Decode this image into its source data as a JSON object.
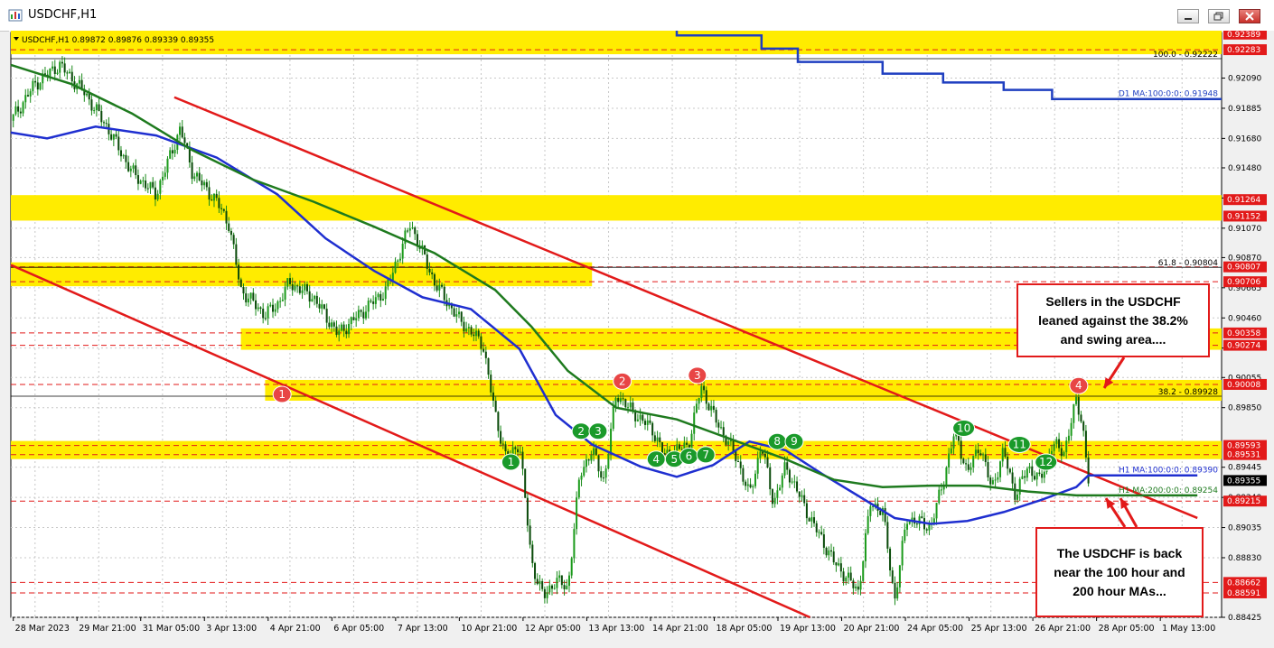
{
  "window": {
    "title": "USDCHF,H1",
    "icon": "chart-window-icon",
    "buttons": [
      "minimize-icon",
      "restore-icon",
      "close-icon"
    ]
  },
  "chart_data": {
    "type": "candlestick",
    "title": "USDCHF,H1",
    "symbol_info": "USDCHF,H1  0.89872 0.89876 0.89339 0.89355",
    "ylim": [
      0.88425,
      0.924
    ],
    "y_ticks": [
      "0.92090",
      "0.91885",
      "0.91680",
      "0.91480",
      "0.91275",
      "0.91070",
      "0.90870",
      "0.90665",
      "0.90460",
      "0.90255",
      "0.90055",
      "0.89850",
      "0.89445",
      "0.89240",
      "0.89035",
      "0.88830",
      "0.88425"
    ],
    "x_ticks": [
      "28 Mar 2023",
      "29 Mar 21:00",
      "31 Mar 05:00",
      "3 Apr 13:00",
      "4 Apr 21:00",
      "6 Apr 05:00",
      "7 Apr 13:00",
      "10 Apr 21:00",
      "12 Apr 05:00",
      "13 Apr 13:00",
      "14 Apr 21:00",
      "18 Apr 05:00",
      "19 Apr 13:00",
      "20 Apr 21:00",
      "24 Apr 05:00",
      "25 Apr 13:00",
      "26 Apr 21:00",
      "28 Apr 05:00",
      "1 May 13:00"
    ],
    "price_labels": [
      {
        "text": "0.92389",
        "value": 0.92389,
        "color": "#e21a1a"
      },
      {
        "text": "0.92283",
        "value": 0.92283,
        "color": "#e21a1a"
      },
      {
        "text": "0.91264",
        "value": 0.91264,
        "color": "#e21a1a"
      },
      {
        "text": "0.91152",
        "value": 0.91152,
        "color": "#e21a1a"
      },
      {
        "text": "0.90807",
        "value": 0.90807,
        "color": "#e21a1a"
      },
      {
        "text": "0.90706",
        "value": 0.90706,
        "color": "#e21a1a"
      },
      {
        "text": "0.90358",
        "value": 0.90358,
        "color": "#e21a1a"
      },
      {
        "text": "0.90274",
        "value": 0.90274,
        "color": "#e21a1a"
      },
      {
        "text": "0.90008",
        "value": 0.90008,
        "color": "#e21a1a"
      },
      {
        "text": "0.89593",
        "value": 0.89593,
        "color": "#e21a1a"
      },
      {
        "text": "0.89531",
        "value": 0.89531,
        "color": "#e21a1a"
      },
      {
        "text": "0.89355",
        "value": 0.89355,
        "color": "#000000"
      },
      {
        "text": "0.89215",
        "value": 0.89215,
        "color": "#e21a1a"
      },
      {
        "text": "0.88662",
        "value": 0.88662,
        "color": "#e21a1a"
      },
      {
        "text": "0.88591",
        "value": 0.88591,
        "color": "#e21a1a"
      }
    ],
    "zones": [
      {
        "lo": 0.92283,
        "hi": 0.92389,
        "from": 0.0,
        "to": 1.0
      },
      {
        "lo": 0.91152,
        "hi": 0.91264,
        "from": 0.0,
        "to": 1.0
      },
      {
        "lo": 0.90706,
        "hi": 0.90807,
        "from": 0.0,
        "to": 0.48
      },
      {
        "lo": 0.90274,
        "hi": 0.90358,
        "from": 0.19,
        "to": 1.0
      },
      {
        "lo": 0.89928,
        "hi": 0.90008,
        "from": 0.21,
        "to": 1.0
      },
      {
        "lo": 0.89531,
        "hi": 0.89593,
        "from": 0.0,
        "to": 1.0
      }
    ],
    "dashed_levels": [
      0.92283,
      0.90807,
      0.90706,
      0.90358,
      0.90274,
      0.90008,
      0.89593,
      0.89531,
      0.89215,
      0.88662,
      0.88591
    ],
    "fib_levels": [
      {
        "label": "100.0 - 0.92222",
        "value": 0.92222
      },
      {
        "label": "61.8 - 0.90804",
        "value": 0.90804
      },
      {
        "label": "38.2 - 0.89928",
        "value": 0.89928
      }
    ],
    "series": [
      {
        "name": "D1 MA:100:0:0: 0.91948",
        "color": "#1f3fc0",
        "points": [
          [
            0.51,
            0.9243
          ],
          [
            0.55,
            0.9243
          ],
          [
            0.55,
            0.9238
          ],
          [
            0.62,
            0.9238
          ],
          [
            0.62,
            0.9229
          ],
          [
            0.65,
            0.9229
          ],
          [
            0.65,
            0.922
          ],
          [
            0.72,
            0.922
          ],
          [
            0.72,
            0.9212
          ],
          [
            0.77,
            0.9212
          ],
          [
            0.77,
            0.9206
          ],
          [
            0.82,
            0.9206
          ],
          [
            0.82,
            0.9201
          ],
          [
            0.86,
            0.9201
          ],
          [
            0.86,
            0.91948
          ],
          [
            1.0,
            0.91948
          ]
        ]
      },
      {
        "name": "H1 MA:100:0:0: 0.89390",
        "color": "#1f2fd0",
        "points": [
          [
            0,
            0.9172
          ],
          [
            0.03,
            0.9168
          ],
          [
            0.07,
            0.9176
          ],
          [
            0.12,
            0.917
          ],
          [
            0.17,
            0.9155
          ],
          [
            0.22,
            0.913
          ],
          [
            0.26,
            0.91
          ],
          [
            0.3,
            0.9078
          ],
          [
            0.34,
            0.906
          ],
          [
            0.38,
            0.9052
          ],
          [
            0.42,
            0.9025
          ],
          [
            0.45,
            0.898
          ],
          [
            0.48,
            0.896
          ],
          [
            0.52,
            0.8945
          ],
          [
            0.55,
            0.8938
          ],
          [
            0.58,
            0.8946
          ],
          [
            0.61,
            0.8962
          ],
          [
            0.64,
            0.8956
          ],
          [
            0.67,
            0.894
          ],
          [
            0.7,
            0.8925
          ],
          [
            0.73,
            0.891
          ],
          [
            0.76,
            0.8906
          ],
          [
            0.79,
            0.8908
          ],
          [
            0.82,
            0.8914
          ],
          [
            0.85,
            0.8922
          ],
          [
            0.88,
            0.8931
          ],
          [
            0.89,
            0.8939
          ],
          [
            0.98,
            0.8939
          ]
        ]
      },
      {
        "name": "H1 MA:200:0:0: 0.89254",
        "color": "#1e7a1e",
        "points": [
          [
            0,
            0.9218
          ],
          [
            0.05,
            0.9205
          ],
          [
            0.1,
            0.9185
          ],
          [
            0.15,
            0.916
          ],
          [
            0.2,
            0.914
          ],
          [
            0.25,
            0.9125
          ],
          [
            0.3,
            0.9108
          ],
          [
            0.35,
            0.909
          ],
          [
            0.4,
            0.9065
          ],
          [
            0.43,
            0.904
          ],
          [
            0.46,
            0.901
          ],
          [
            0.5,
            0.8985
          ],
          [
            0.55,
            0.8977
          ],
          [
            0.6,
            0.8962
          ],
          [
            0.64,
            0.895
          ],
          [
            0.68,
            0.8936
          ],
          [
            0.72,
            0.8931
          ],
          [
            0.76,
            0.8932
          ],
          [
            0.8,
            0.8932
          ],
          [
            0.84,
            0.8928
          ],
          [
            0.88,
            0.89254
          ],
          [
            0.98,
            0.89254
          ]
        ]
      }
    ],
    "channel_lines": [
      {
        "from": [
          0.135,
          0.9196
        ],
        "to": [
          0.98,
          0.891
        ]
      },
      {
        "from": [
          0.0,
          0.9082
        ],
        "to": [
          0.66,
          0.88425
        ]
      }
    ],
    "labels": [
      {
        "text": "1",
        "x": 0.224,
        "y": 0.8994,
        "color": "#e84545"
      },
      {
        "text": "2",
        "x": 0.505,
        "y": 0.9003,
        "color": "#e84545"
      },
      {
        "text": "3",
        "x": 0.567,
        "y": 0.9007,
        "color": "#e84545"
      },
      {
        "text": "4",
        "x": 0.882,
        "y": 0.9,
        "color": "#e84545"
      },
      {
        "text": "1",
        "x": 0.413,
        "y": 0.8948,
        "color": "#1a9a2a"
      },
      {
        "text": "2",
        "x": 0.471,
        "y": 0.8969,
        "color": "#1a9a2a"
      },
      {
        "text": "3",
        "x": 0.485,
        "y": 0.8969,
        "color": "#1a9a2a"
      },
      {
        "text": "4",
        "x": 0.533,
        "y": 0.895,
        "color": "#1a9a2a"
      },
      {
        "text": "5",
        "x": 0.548,
        "y": 0.895,
        "color": "#1a9a2a"
      },
      {
        "text": "6",
        "x": 0.56,
        "y": 0.8952,
        "color": "#1a9a2a"
      },
      {
        "text": "7",
        "x": 0.574,
        "y": 0.8953,
        "color": "#1a9a2a"
      },
      {
        "text": "8",
        "x": 0.633,
        "y": 0.8962,
        "color": "#1a9a2a"
      },
      {
        "text": "9",
        "x": 0.647,
        "y": 0.8962,
        "color": "#1a9a2a"
      },
      {
        "text": "10",
        "x": 0.787,
        "y": 0.8971,
        "color": "#1a9a2a"
      },
      {
        "text": "11",
        "x": 0.833,
        "y": 0.896,
        "color": "#1a9a2a"
      },
      {
        "text": "12",
        "x": 0.855,
        "y": 0.8948,
        "color": "#1a9a2a"
      }
    ],
    "price_path": [
      [
        0,
        0.918
      ],
      [
        0.02,
        0.9205
      ],
      [
        0.04,
        0.9218
      ],
      [
        0.06,
        0.92
      ],
      [
        0.08,
        0.9175
      ],
      [
        0.1,
        0.9145
      ],
      [
        0.12,
        0.913
      ],
      [
        0.14,
        0.9175
      ],
      [
        0.15,
        0.9145
      ],
      [
        0.17,
        0.9125
      ],
      [
        0.18,
        0.911
      ],
      [
        0.19,
        0.9065
      ],
      [
        0.21,
        0.9048
      ],
      [
        0.22,
        0.9055
      ],
      [
        0.23,
        0.907
      ],
      [
        0.25,
        0.906
      ],
      [
        0.27,
        0.9035
      ],
      [
        0.29,
        0.905
      ],
      [
        0.31,
        0.9065
      ],
      [
        0.33,
        0.911
      ],
      [
        0.35,
        0.907
      ],
      [
        0.37,
        0.9045
      ],
      [
        0.39,
        0.9028
      ],
      [
        0.4,
        0.898
      ],
      [
        0.41,
        0.8948
      ],
      [
        0.42,
        0.8962
      ],
      [
        0.43,
        0.888
      ],
      [
        0.44,
        0.8856
      ],
      [
        0.45,
        0.8868
      ],
      [
        0.46,
        0.8862
      ],
      [
        0.47,
        0.894
      ],
      [
        0.48,
        0.8956
      ],
      [
        0.49,
        0.8935
      ],
      [
        0.5,
        0.8995
      ],
      [
        0.51,
        0.8985
      ],
      [
        0.53,
        0.897
      ],
      [
        0.54,
        0.8952
      ],
      [
        0.56,
        0.896
      ],
      [
        0.57,
        0.9
      ],
      [
        0.58,
        0.898
      ],
      [
        0.6,
        0.895
      ],
      [
        0.61,
        0.8925
      ],
      [
        0.62,
        0.896
      ],
      [
        0.63,
        0.892
      ],
      [
        0.64,
        0.8945
      ],
      [
        0.66,
        0.891
      ],
      [
        0.68,
        0.888
      ],
      [
        0.7,
        0.886
      ],
      [
        0.71,
        0.892
      ],
      [
        0.72,
        0.8915
      ],
      [
        0.73,
        0.8854
      ],
      [
        0.74,
        0.891
      ],
      [
        0.76,
        0.8904
      ],
      [
        0.77,
        0.8935
      ],
      [
        0.78,
        0.897
      ],
      [
        0.79,
        0.894
      ],
      [
        0.8,
        0.896
      ],
      [
        0.81,
        0.893
      ],
      [
        0.82,
        0.8955
      ],
      [
        0.83,
        0.8925
      ],
      [
        0.84,
        0.8945
      ],
      [
        0.85,
        0.8935
      ],
      [
        0.86,
        0.896
      ],
      [
        0.87,
        0.8955
      ],
      [
        0.88,
        0.899
      ],
      [
        0.885,
        0.8975
      ],
      [
        0.89,
        0.89355
      ]
    ]
  },
  "annotations": {
    "top": "Sellers in the USDCHF leaned against the 38.2% and swing area....",
    "bottom": "The USDCHF is back near the 100 hour and 200 hour MAs..."
  }
}
